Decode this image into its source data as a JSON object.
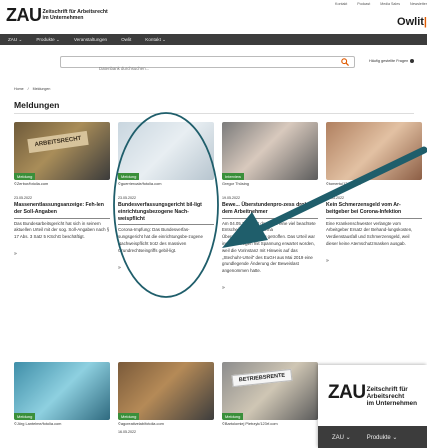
{
  "utility_links": [
    "Kontakt",
    "Podcast",
    "Media Sales",
    "Newsletter"
  ],
  "logo": {
    "mark": "ZAU",
    "line1": "Zeitschrift für Arbeitsrecht",
    "line2": "im Unternehmen"
  },
  "brand_right": {
    "name": "Owlit",
    "mark": "|"
  },
  "nav": [
    "ZAU ⌄",
    "Produkte ⌄",
    "Veranstaltungen",
    "Owlit",
    "Kontakt ⌄"
  ],
  "search": {
    "placeholder": "Datenbank durchsuchen..."
  },
  "faq": "Häufig gestellte Fragen",
  "breadcrumb": [
    "Home",
    "/",
    "Meldungen"
  ],
  "page_title": "Meldungen",
  "cards": [
    {
      "badge": "Meldung",
      "credit": "©Zerbor/fotolia.com",
      "image_text": "ARBEITSRECHT",
      "date": "23.05.2022",
      "headline": "Massenentlassungsanzeige: Feh-len der Soll-Angaben",
      "body": "Das Bundesarbeitsgericht hat sich in seinem aktuellen Urteil mit der sog. Soll-Angaben nach § 17 Abs. 3 Satz 5 KSchG beschäftigt.",
      "more": "»"
    },
    {
      "badge": "Meldung",
      "credit": "©guerrieroale/fotolia.com",
      "date": "23.05.2022",
      "headline": "Bundesverfassungsgericht bil-ligt einrichtungsbezogene Nach-weispflicht",
      "body": "Corona-Impfung: Das Bundesverfas-sungsgericht hat die einrichtungsbe-zogene Nachweispflicht trotz des massiven Grundrechtseingriffs gebil-ligt.",
      "more": "»"
    },
    {
      "badge": "Interview",
      "credit": "Gregor Thüsing",
      "date": "19.05.2022",
      "headline": "Bewe... Überstundenpro-zess droht dem Arbeitnehmer",
      "body": "Am 04.05.2022 hat das BAG eine viel beachtete Entscheidung zum Thema Überstundenabgeltung getroffen. Das Urteil war insb. deswegen mit Spannung erwartet worden, weil die Vorinstanz mit Hinweis auf das „Stechuhr-Urteil\" des EuGH aus Mai 2019 eine grundlegende Änderung der Beweislast angenommen hatte.",
      "more": "»"
    },
    {
      "badge": "",
      "credit": "©tomertu/123rf.com",
      "date": "17.05.2022",
      "headline": "Kein Schmerzensgeld vom Ar-beitgeber bei Corona-Infektion",
      "body": "Eine Krankenschwester verlangte vom Arbeitgeber Ersatz der Behand-lungskosten, Verdienstausfall und Schmerzensgeld, weil dieser keine Atemschutzmasken ausgab.",
      "more": "»"
    },
    {
      "badge": "Meldung",
      "credit": "©Jörg Lantelme/fotolia.com"
    },
    {
      "badge": "Meldung",
      "credit": "©agcreativelab/fotolia.com",
      "date": "16.05.2022"
    },
    {
      "badge": "Meldung",
      "credit": "©Bartolomiej Pietrzyk/123rf.com",
      "image_text": "BETRIEBSRENTE"
    }
  ],
  "float_panel": {
    "nav": [
      "ZAU ⌄",
      "Produkte ⌄"
    ]
  },
  "colors": {
    "nav_bg": "#3c3c3c",
    "badge_green": "#3a8f3a",
    "search_orange": "#e05a00",
    "annotation_teal": "#1f5e6b"
  }
}
